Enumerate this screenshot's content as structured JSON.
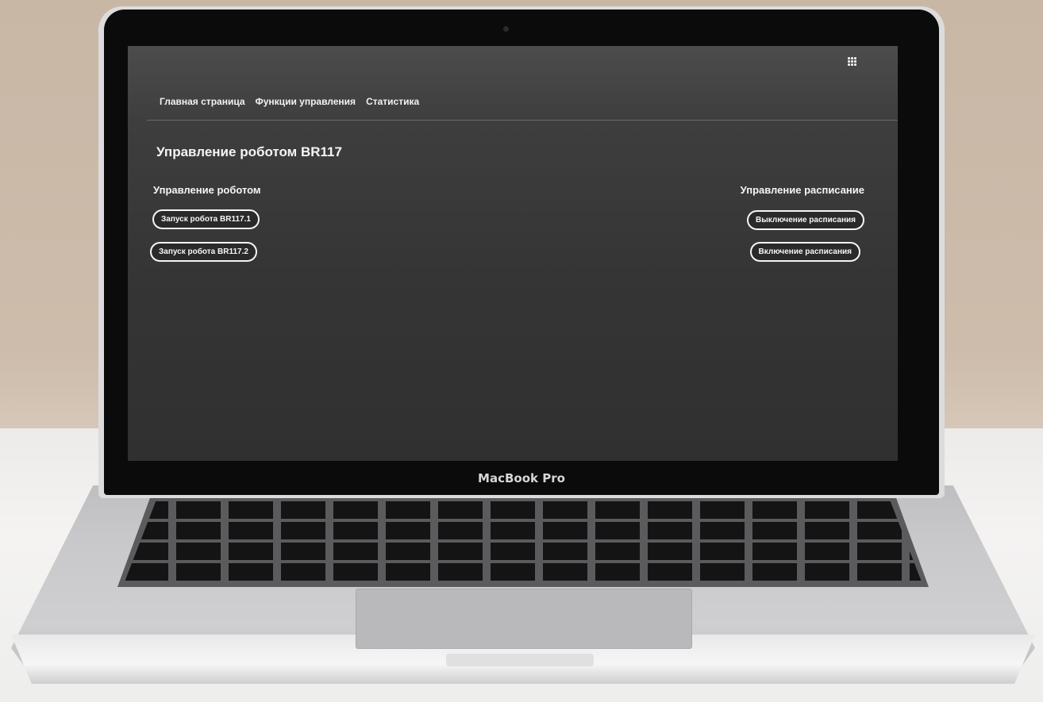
{
  "device": {
    "brand_label": "MacBook Pro"
  },
  "header": {
    "apps_icon": "grid-apps-icon",
    "nav": [
      {
        "label": "Главная страница"
      },
      {
        "label": "Функции управления"
      },
      {
        "label": "Статистика"
      }
    ]
  },
  "main": {
    "title": "Управление роботом BR117",
    "robot_section": {
      "title": "Управление роботом",
      "buttons": [
        {
          "label": "Запуск робота BR117.1"
        },
        {
          "label": "Запуск робота BR117.2"
        }
      ]
    },
    "schedule_section": {
      "title": "Управление расписание",
      "buttons": [
        {
          "label": "Выключение расписания"
        },
        {
          "label": "Включение расписания"
        }
      ]
    }
  },
  "colors": {
    "screen_bg": "#353535",
    "text": "#f5f5f5",
    "button_border": "#f5f5f5"
  }
}
